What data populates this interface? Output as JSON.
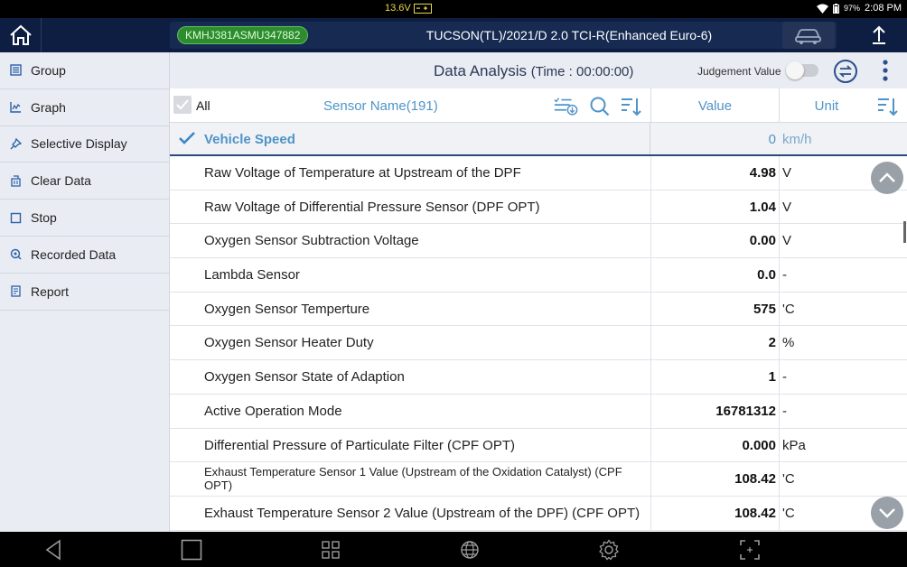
{
  "status_bar": {
    "voltage": "13.6V",
    "battery_percent": "97%",
    "time": "2:08 PM"
  },
  "header": {
    "vin": "KMHJ381ASMU347882",
    "vehicle": "TUCSON(TL)/2021/D 2.0 TCI-R(Enhanced Euro-6)"
  },
  "sidebar": {
    "items": [
      {
        "label": "Group",
        "icon": "group-icon"
      },
      {
        "label": "Graph",
        "icon": "graph-icon"
      },
      {
        "label": "Selective Display",
        "icon": "pin-icon"
      },
      {
        "label": "Clear Data",
        "icon": "clear-icon"
      },
      {
        "label": "Stop",
        "icon": "stop-icon"
      },
      {
        "label": "Recorded Data",
        "icon": "search-record-icon"
      },
      {
        "label": "Report",
        "icon": "report-icon"
      }
    ]
  },
  "toolbar": {
    "title": "Data Analysis",
    "time_label": "(Time : 00:00:00)",
    "judgement_label": "Judgement Value"
  },
  "columns": {
    "all_label": "All",
    "sensor_name": "Sensor Name(191)",
    "value": "Value",
    "unit": "Unit"
  },
  "selected_row": {
    "name": "Vehicle Speed",
    "value": "0",
    "unit": "km/h"
  },
  "rows": [
    {
      "name": "Raw Voltage of Temperature at Upstream of the DPF",
      "value": "4.98",
      "unit": "V"
    },
    {
      "name": "Raw Voltage of Differential Pressure Sensor (DPF OPT)",
      "value": "1.04",
      "unit": "V"
    },
    {
      "name": "Oxygen Sensor Subtraction Voltage",
      "value": "0.00",
      "unit": "V"
    },
    {
      "name": "Lambda Sensor",
      "value": "0.0",
      "unit": "-"
    },
    {
      "name": "Oxygen Sensor Temperture",
      "value": "575",
      "unit": "'C"
    },
    {
      "name": "Oxygen Sensor Heater Duty",
      "value": "2",
      "unit": "%"
    },
    {
      "name": "Oxygen Sensor State of Adaption",
      "value": "1",
      "unit": "-"
    },
    {
      "name": "Active Operation Mode",
      "value": "16781312",
      "unit": "-"
    },
    {
      "name": "Differential Pressure of Particulate Filter (CPF OPT)",
      "value": "0.000",
      "unit": "kPa"
    },
    {
      "name": "Exhaust Temperature Sensor 1 Value (Upstream of the Oxidation Catalyst) (CPF OPT)",
      "value": "108.42",
      "unit": "'C"
    },
    {
      "name": "Exhaust Temperature Sensor 2 Value (Upstream of the DPF) (CPF OPT)",
      "value": "108.42",
      "unit": "'C"
    }
  ],
  "colors": {
    "header_bg": "#0e1e42",
    "vin_badge": "#2e8b2e",
    "accent_blue": "#4f94c8",
    "sidebar_bg": "#e9ecf3"
  }
}
